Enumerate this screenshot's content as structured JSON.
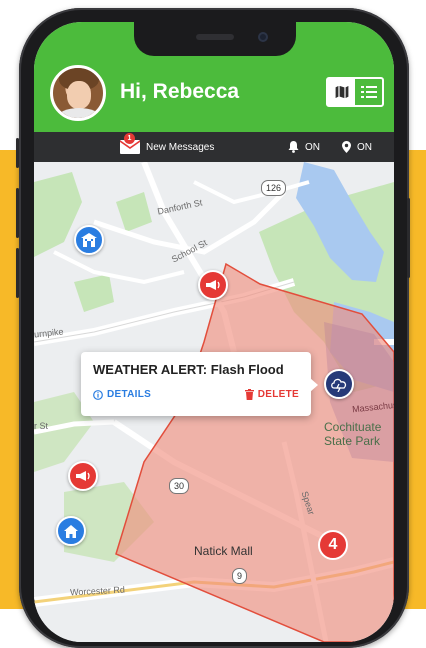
{
  "header": {
    "greeting": "Hi, Rebecca",
    "toggle_options": [
      {
        "icon": "map-icon",
        "active": true
      },
      {
        "icon": "list-icon",
        "active": false
      }
    ],
    "color": "#4cbb3c"
  },
  "status_bar": {
    "messages_badge": "1",
    "messages_label": "New Messages",
    "notifications_label": "ON",
    "location_label": "ON"
  },
  "alert_popup": {
    "title": "WEATHER ALERT: Flash Flood",
    "details_label": "DETAILS",
    "delete_label": "DELETE"
  },
  "map": {
    "labels": {
      "danforth": "Danforth St",
      "school": "School St",
      "turnpike": "urnpike",
      "st_left": "r St",
      "spear": "Spear",
      "natick_mall": "Natick Mall",
      "worcester": "Worcester Rd",
      "massachusetts": "Massachus",
      "park": "Cochituate State Park"
    },
    "road_shields": {
      "r126": "126",
      "r30": "30",
      "r9": "9"
    },
    "cluster_count": "4",
    "flood_zone_color": "#f08c7c"
  }
}
